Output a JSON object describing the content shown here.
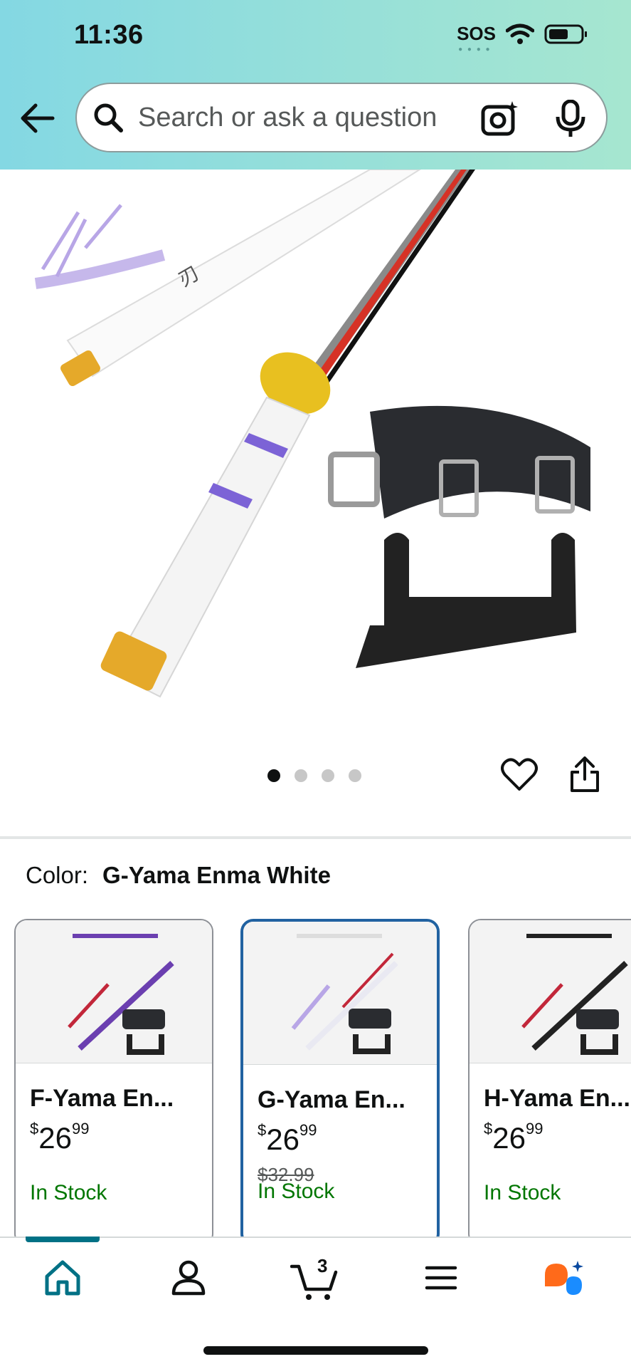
{
  "status_bar": {
    "time": "11:36",
    "sos": "SOS"
  },
  "search": {
    "placeholder": "Search or ask a question"
  },
  "gallery": {
    "image_count": 4,
    "current_index": 1
  },
  "color": {
    "label": "Color:",
    "value": "G-Yama Enma White"
  },
  "variants": [
    {
      "name": "F-Yama En...",
      "price_whole": "26",
      "price_frac": "99",
      "currency": "$",
      "list_price": "",
      "stock": "In Stock",
      "selected": false
    },
    {
      "name": "G-Yama En...",
      "price_whole": "26",
      "price_frac": "99",
      "currency": "$",
      "list_price": "$32.99",
      "stock": "In Stock",
      "selected": true
    },
    {
      "name": "H-Yama En...",
      "price_whole": "26",
      "price_frac": "99",
      "currency": "$",
      "list_price": "",
      "stock": "In Stock",
      "selected": false
    }
  ],
  "tabbar": {
    "cart_count": "3",
    "active": "home"
  },
  "colors": {
    "accent": "#007185",
    "stock_green": "#007600",
    "selected_border": "#2162a1"
  }
}
